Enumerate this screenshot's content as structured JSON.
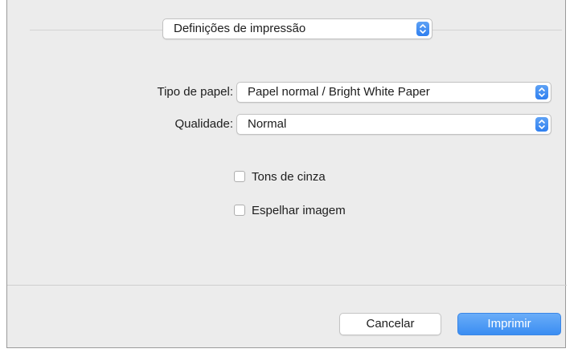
{
  "print_settings": {
    "section_selected": "Definições de impressão",
    "paper_type": {
      "label": "Tipo de papel:",
      "value": "Papel normal / Bright White Paper"
    },
    "quality": {
      "label": "Qualidade:",
      "value": "Normal"
    },
    "grayscale": {
      "label": "Tons de cinza",
      "checked": false
    },
    "mirror_image": {
      "label": "Espelhar imagem",
      "checked": false
    }
  },
  "buttons": {
    "cancel": "Cancelar",
    "print": "Imprimir"
  },
  "colors": {
    "accent": "#3a8df2",
    "dialog_bg": "#ececec"
  }
}
